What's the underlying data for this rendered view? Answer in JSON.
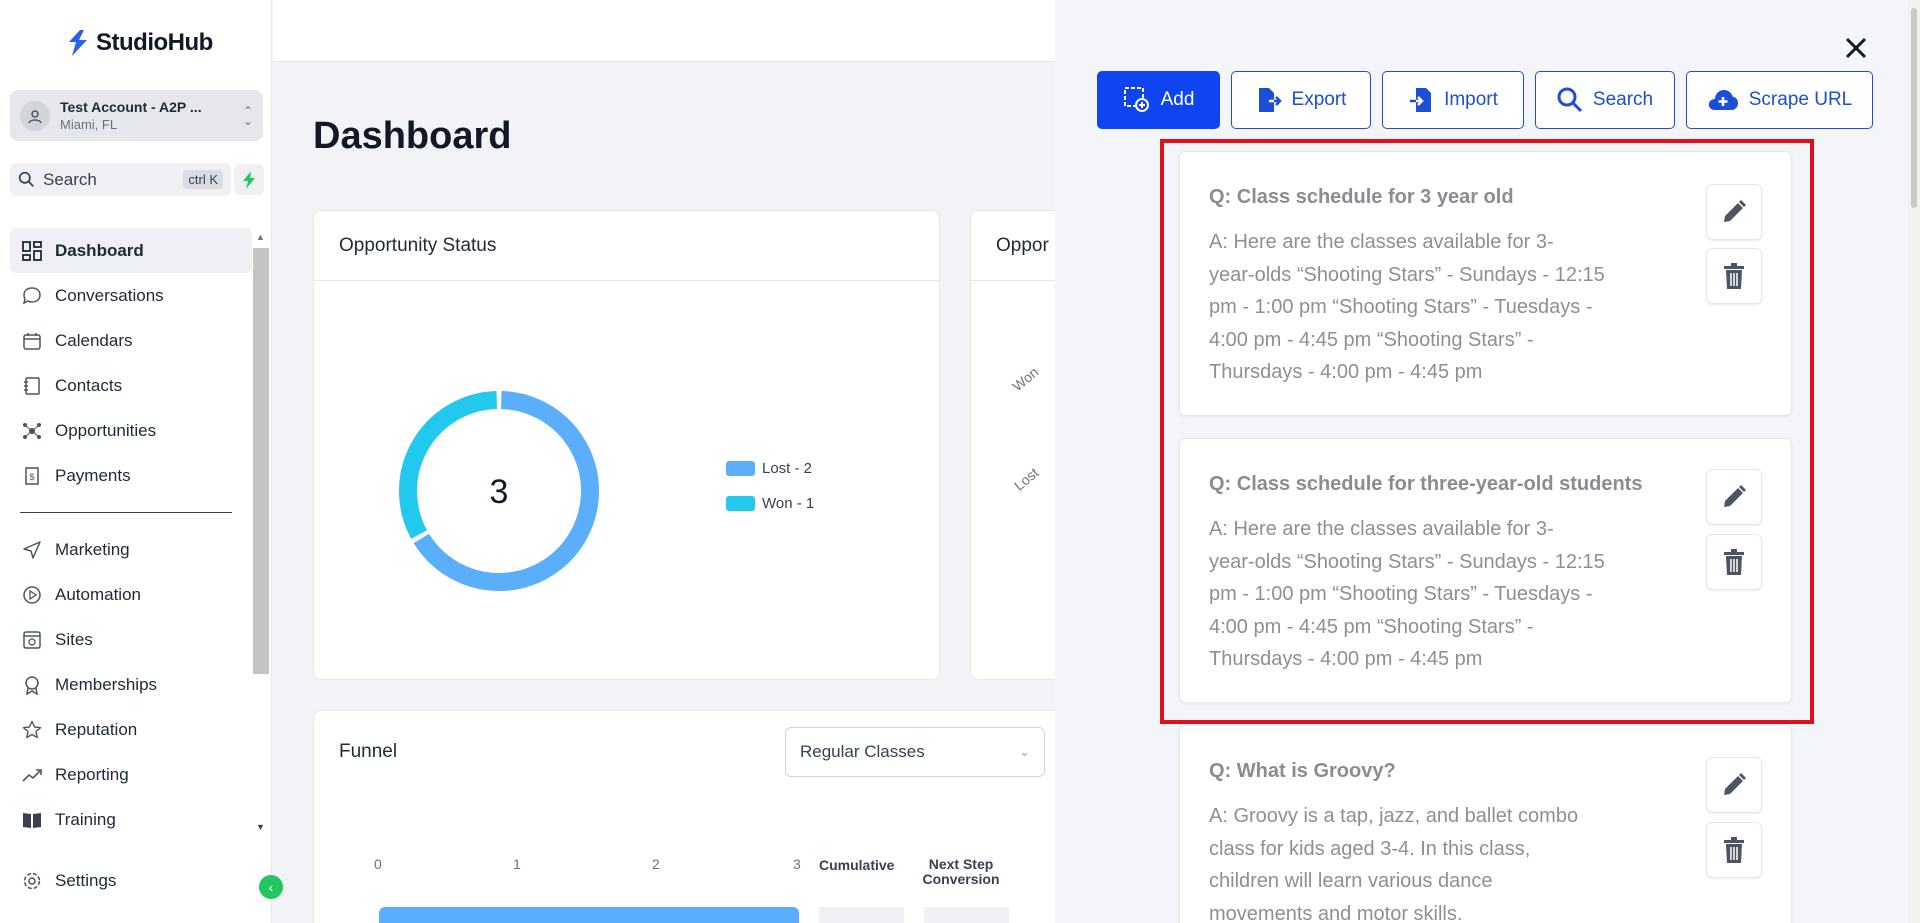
{
  "brand": {
    "name": "StudioHub",
    "accent": "#0f45f0"
  },
  "account": {
    "name": "Test Account - A2P ...",
    "location": "Miami, FL"
  },
  "search": {
    "label": "Search",
    "shortcut": "ctrl K"
  },
  "nav": {
    "items": [
      {
        "label": "Dashboard",
        "icon": "grid-icon"
      },
      {
        "label": "Conversations",
        "icon": "chat-bubble-icon"
      },
      {
        "label": "Calendars",
        "icon": "calendar-icon"
      },
      {
        "label": "Contacts",
        "icon": "contacts-book-icon"
      },
      {
        "label": "Opportunities",
        "icon": "network-icon"
      },
      {
        "label": "Payments",
        "icon": "receipt-icon"
      },
      {
        "label": "Marketing",
        "icon": "send-icon"
      },
      {
        "label": "Automation",
        "icon": "play-circle-icon"
      },
      {
        "label": "Sites",
        "icon": "web-icon"
      },
      {
        "label": "Memberships",
        "icon": "award-icon"
      },
      {
        "label": "Reputation",
        "icon": "star-icon"
      },
      {
        "label": "Reporting",
        "icon": "trending-icon"
      },
      {
        "label": "Training",
        "icon": "book-icon"
      }
    ],
    "settings": "Settings"
  },
  "main": {
    "title": "Dashboard",
    "opportunity_status": {
      "title": "Opportunity Status",
      "total": "3",
      "legend": [
        "Lost - 2",
        "Won - 1"
      ]
    },
    "second_card_title": "Oppor",
    "rotated_labels": [
      "Won",
      "Lost"
    ],
    "funnel": {
      "title": "Funnel",
      "dropdown_value": "Regular Classes",
      "ticks": [
        "0",
        "1",
        "2",
        "3"
      ],
      "cumulative": "Cumulative",
      "next_step": "Next Step",
      "conversion": "Conversion"
    }
  },
  "chart_data": {
    "type": "pie",
    "categories": [
      "Lost",
      "Won"
    ],
    "values": [
      2,
      1
    ],
    "colors": [
      "#5aaefb",
      "#22c8ee"
    ],
    "title": "Opportunity Status",
    "center_label": "3",
    "legend_position": "right"
  },
  "panel": {
    "toolbar": {
      "add": "Add",
      "export": "Export",
      "import": "Import",
      "search": "Search",
      "scrape": "Scrape URL"
    },
    "faqs": [
      {
        "question": "Q: Class schedule for 3 year old",
        "answer_lines": [
          "A: Here are the classes available for 3-",
          "year-olds “Shooting Stars” - Sundays - 12:15",
          "pm - 1:00 pm “Shooting Stars” - Tuesdays -",
          "4:00 pm - 4:45 pm “Shooting Stars” -",
          "Thursdays - 4:00 pm - 4:45 pm"
        ]
      },
      {
        "question": "Q: Class schedule for three-year-old students",
        "answer_lines": [
          "A: Here are the classes available for 3-",
          "year-olds “Shooting Stars” - Sundays - 12:15",
          "pm - 1:00 pm “Shooting Stars” - Tuesdays -",
          "4:00 pm - 4:45 pm “Shooting Stars” -",
          "Thursdays - 4:00 pm - 4:45 pm"
        ]
      },
      {
        "question": "Q: What is Groovy?",
        "answer_lines": [
          "A: Groovy is a tap, jazz, and ballet combo",
          "class for kids aged 3-4. In this class,",
          "children will learn various dance",
          "movements and motor skills."
        ]
      }
    ]
  }
}
